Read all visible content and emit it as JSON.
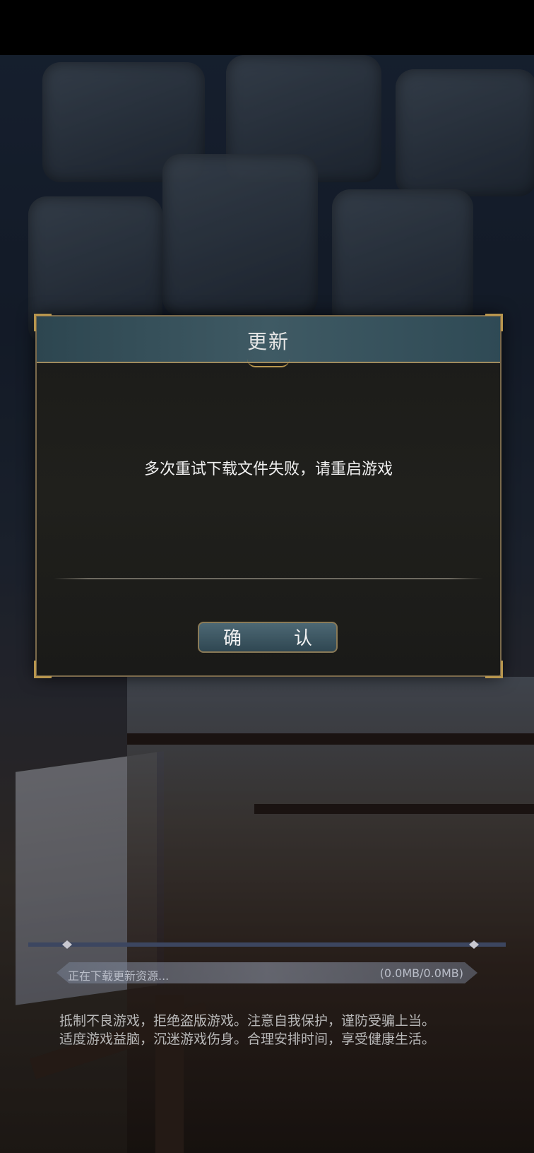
{
  "dialog": {
    "title": "更新",
    "message": "多次重试下载文件失败，请重启游戏",
    "confirm_label": "确　认"
  },
  "download": {
    "status": "正在下载更新资源...",
    "size": "(0.0MB/0.0MB)",
    "progress": 0.0
  },
  "notice": {
    "line1": "抵制不良游戏，拒绝盗版游戏。注意自我保护，谨防受骗上当。",
    "line2": "适度游戏益脑，沉迷游戏伤身。合理安排时间，享受健康生活。"
  },
  "colors": {
    "frame_gold": "#b8964e",
    "header_teal": "#3f5a64",
    "button_teal": "#4d6874"
  }
}
